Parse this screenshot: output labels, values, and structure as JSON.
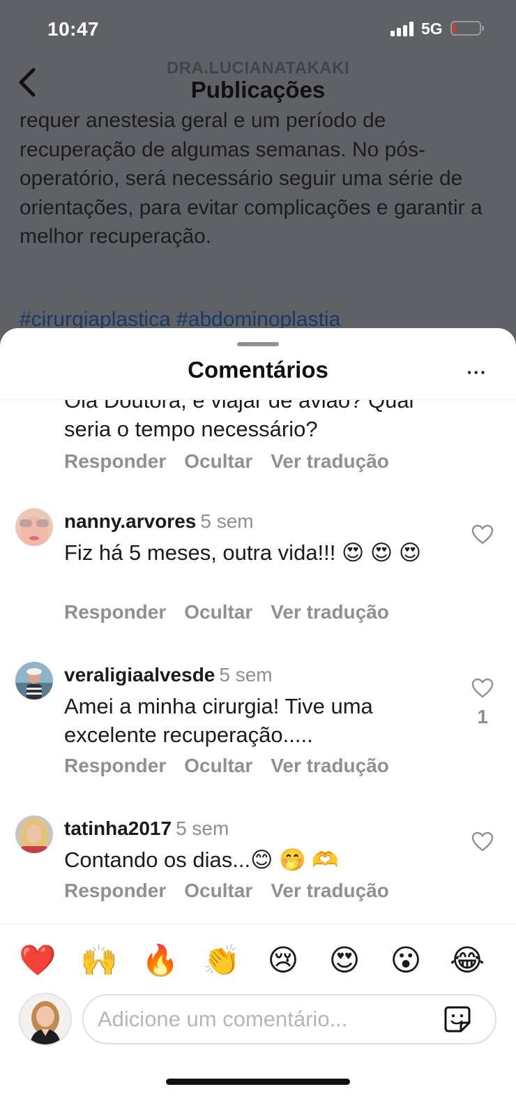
{
  "status_bar": {
    "time": "10:47",
    "network": "5G",
    "battery_color": "#e0342a"
  },
  "post": {
    "account": "DRA.LUCIANATAKAKI",
    "title": "Publicações",
    "text": "requer anestesia geral e um período de recuperação de algumas semanas. No pós-operatório, será necessário seguir uma série de orientações, para evitar complicações e garantir a melhor recuperação.",
    "hashtags": "#cirurgiaplastica #abdominoplastia"
  },
  "sheet": {
    "title": "Comentários",
    "more_label": "···"
  },
  "comment_actions": {
    "reply": "Responder",
    "hide": "Ocultar",
    "translate": "Ver tradução"
  },
  "comments": [
    {
      "partial_text": "Olá Doutora, e viajar de avião? Qual seria o tempo necessário?"
    },
    {
      "user": "nanny.arvores",
      "time": "5 sem",
      "text": "Fiz há 5 meses, outra vida!!! 😍 😍 😍",
      "likes": ""
    },
    {
      "user": "veraligiaalvesde",
      "time": "5 sem",
      "text": "Amei a minha cirurgia! Tive uma excelente recuperação.....",
      "likes": "1"
    },
    {
      "user": "tatinha2017",
      "time": "5 sem",
      "text": "Contando os dias...😊 🤭 🫶",
      "likes": ""
    }
  ],
  "reactions": [
    "❤️",
    "🙌",
    "🔥",
    "👏",
    "😢",
    "😍",
    "😮",
    "😂"
  ],
  "composer": {
    "placeholder": "Adicione um comentário..."
  },
  "icons": {
    "back": "chevron-left-icon",
    "like": "heart-outline-icon",
    "sticker": "sticker-icon"
  }
}
